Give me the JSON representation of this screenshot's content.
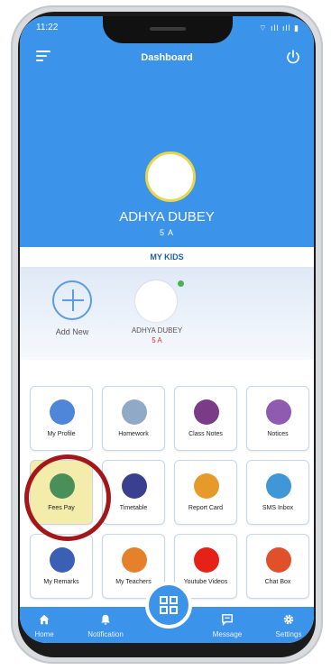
{
  "status": {
    "time": "11:22",
    "icons": "⌔ ıll ıll ▮"
  },
  "header": {
    "title": "Dashboard"
  },
  "profile": {
    "name": "ADHYA DUBEY",
    "class": "5 A"
  },
  "kids": {
    "section_label": "MY KIDS",
    "add_new_label": "Add New",
    "items": [
      {
        "name": "ADHYA DUBEY",
        "class": "5 A"
      }
    ]
  },
  "tiles": [
    {
      "label": "My Profile",
      "icon": "student-icon",
      "color": "#4f86d9"
    },
    {
      "label": "Homework",
      "icon": "homework-icon",
      "color": "#8fa9c6"
    },
    {
      "label": "Class Notes",
      "icon": "notes-icon",
      "color": "#7b3b86"
    },
    {
      "label": "Notices",
      "icon": "notice-board-icon",
      "color": "#8e5bb0"
    },
    {
      "label": "Fees Pay",
      "icon": "money-icon",
      "color": "#4a8f5a"
    },
    {
      "label": "Timetable",
      "icon": "timetable-icon",
      "color": "#3a3f8f"
    },
    {
      "label": "Report Card",
      "icon": "report-card-icon",
      "color": "#e59a2b"
    },
    {
      "label": "SMS Inbox",
      "icon": "sms-inbox-icon",
      "color": "#3f97d8"
    },
    {
      "label": "My Remarks",
      "icon": "remarks-icon",
      "color": "#3b5fb5"
    },
    {
      "label": "My Teachers",
      "icon": "teacher-icon",
      "color": "#e5812b"
    },
    {
      "label": "Youtube Videos",
      "icon": "youtube-icon",
      "color": "#e62117"
    },
    {
      "label": "Chat Box",
      "icon": "chat-icon",
      "color": "#e0502b"
    }
  ],
  "nav": [
    {
      "label": "Home",
      "icon": "home-icon"
    },
    {
      "label": "Notification",
      "icon": "bell-icon"
    },
    {
      "label": "",
      "icon": "dashboard-grid-icon"
    },
    {
      "label": "Message",
      "icon": "message-icon"
    },
    {
      "label": "Settings",
      "icon": "settings-icon"
    }
  ],
  "colors": {
    "primary": "#3b93ea",
    "highlight_tile": "#f3ecaa",
    "annotation_ring": "#a3171b"
  }
}
